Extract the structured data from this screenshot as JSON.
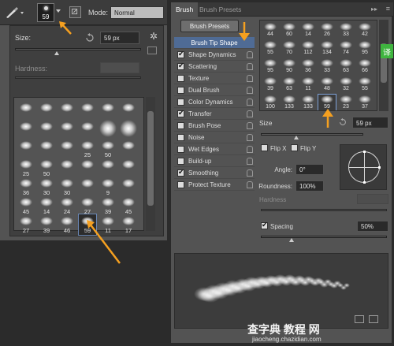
{
  "colors": {
    "accent_orange": "#f5a020",
    "selected_blue": "#4f6b95",
    "panel": "#535353"
  },
  "options_bar": {
    "brush_size": "59",
    "mode_label": "Mode:",
    "mode_value": "Normal"
  },
  "picker": {
    "size_label": "Size:",
    "size_value": "59 px",
    "hardness_label": "Hardness:",
    "presets": [
      {
        "label": ""
      },
      {
        "label": ""
      },
      {
        "label": ""
      },
      {
        "label": ""
      },
      {
        "label": ""
      },
      {
        "label": ""
      },
      {
        "label": ""
      },
      {
        "label": ""
      },
      {
        "label": ""
      },
      {
        "label": ""
      },
      {
        "label": ""
      },
      {
        "label": ""
      },
      {
        "label": ""
      },
      {
        "label": ""
      },
      {
        "label": ""
      },
      {
        "label": "25"
      },
      {
        "label": "50"
      },
      {
        "label": ""
      },
      {
        "label": "25"
      },
      {
        "label": "50"
      },
      {
        "label": ""
      },
      {
        "label": ""
      },
      {
        "label": ""
      },
      {
        "label": ""
      },
      {
        "label": "36"
      },
      {
        "label": "30"
      },
      {
        "label": "30"
      },
      {
        "label": ""
      },
      {
        "label": "9"
      },
      {
        "label": ""
      },
      {
        "label": "45"
      },
      {
        "label": "14"
      },
      {
        "label": "24"
      },
      {
        "label": "27"
      },
      {
        "label": "39"
      },
      {
        "label": "45"
      },
      {
        "label": "27"
      },
      {
        "label": "39"
      },
      {
        "label": "46"
      },
      {
        "label": "59"
      },
      {
        "label": "11"
      },
      {
        "label": "17"
      }
    ]
  },
  "brush_panel": {
    "tabs": [
      "Brush",
      "Brush Presets"
    ],
    "presets_button": "Brush Presets",
    "tip_shape_header": "Brush Tip Shape",
    "options": [
      {
        "label": "Shape Dynamics",
        "checked": true
      },
      {
        "label": "Scattering",
        "checked": true
      },
      {
        "label": "Texture",
        "checked": false
      },
      {
        "label": "Dual Brush",
        "checked": false
      },
      {
        "label": "Color Dynamics",
        "checked": false
      },
      {
        "label": "Transfer",
        "checked": true
      },
      {
        "label": "Brush Pose",
        "checked": false
      },
      {
        "label": "Noise",
        "checked": false
      },
      {
        "label": "Wet Edges",
        "checked": false
      },
      {
        "label": "Build-up",
        "checked": false
      },
      {
        "label": "Smoothing",
        "checked": true
      },
      {
        "label": "Protect Texture",
        "checked": false
      }
    ],
    "tips": [
      {
        "label": "44"
      },
      {
        "label": "60"
      },
      {
        "label": "14"
      },
      {
        "label": "26"
      },
      {
        "label": "33"
      },
      {
        "label": "42"
      },
      {
        "label": "55"
      },
      {
        "label": "70"
      },
      {
        "label": "112"
      },
      {
        "label": "134"
      },
      {
        "label": "74"
      },
      {
        "label": "95"
      },
      {
        "label": "95"
      },
      {
        "label": "90"
      },
      {
        "label": "36"
      },
      {
        "label": "33"
      },
      {
        "label": "63"
      },
      {
        "label": "66"
      },
      {
        "label": "39"
      },
      {
        "label": "63"
      },
      {
        "label": "11"
      },
      {
        "label": "48"
      },
      {
        "label": "32"
      },
      {
        "label": "55"
      },
      {
        "label": "100"
      },
      {
        "label": "133"
      },
      {
        "label": "133"
      },
      {
        "label": "59"
      },
      {
        "label": "23"
      },
      {
        "label": "37"
      }
    ],
    "size_label": "Size",
    "size_value": "59 px",
    "flip_x": "Flip X",
    "flip_y": "Flip Y",
    "angle_label": "Angle:",
    "angle_value": "0°",
    "roundness_label": "Roundness:",
    "roundness_value": "100%",
    "hardness_label": "Hardness",
    "spacing_label": "Spacing",
    "spacing_value": "50%"
  },
  "side_badge": "译",
  "watermark": {
    "text": "查字典 教程 网",
    "url": "jiaocheng.chazidian.com"
  }
}
